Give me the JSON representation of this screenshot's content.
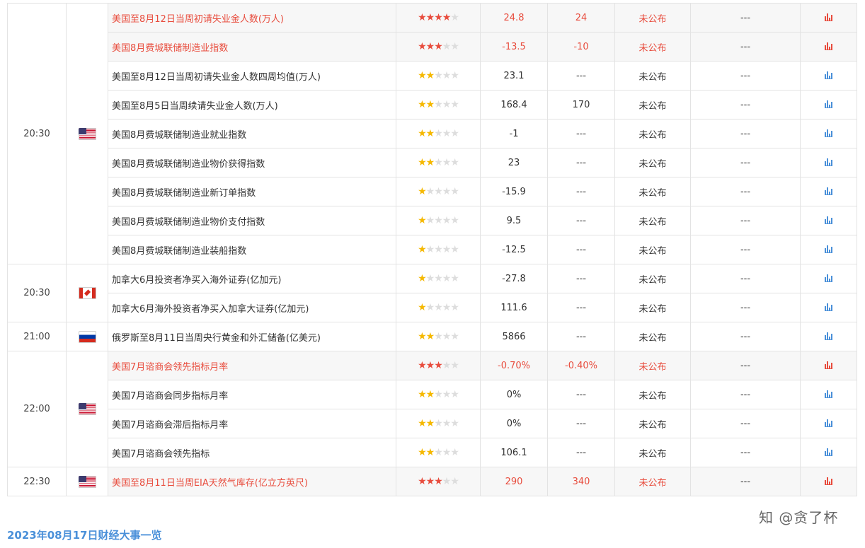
{
  "colors": {
    "accent_red": "#e84c3d",
    "star_yellow": "#f5b800",
    "link_blue": "#4a90d9"
  },
  "rows": [
    {
      "time": "",
      "flag": "",
      "event": "美国至8月12日当周初请失业金人数(万人)",
      "stars": 4,
      "previous": "24.8",
      "forecast": "24",
      "actual": "未公布",
      "impact": "---",
      "important": true
    },
    {
      "time": "",
      "flag": "",
      "event": "美国8月费城联储制造业指数",
      "stars": 3,
      "previous": "-13.5",
      "forecast": "-10",
      "actual": "未公布",
      "impact": "---",
      "important": true
    },
    {
      "time": "20:30",
      "flag": "us",
      "event": "美国至8月12日当周初请失业金人数四周均值(万人)",
      "stars": 2,
      "previous": "23.1",
      "forecast": "---",
      "actual": "未公布",
      "impact": "---",
      "important": false
    },
    {
      "time": "",
      "flag": "",
      "event": "美国至8月5日当周续请失业金人数(万人)",
      "stars": 2,
      "previous": "168.4",
      "forecast": "170",
      "actual": "未公布",
      "impact": "---",
      "important": false
    },
    {
      "time": "",
      "flag": "",
      "event": "美国8月费城联储制造业就业指数",
      "stars": 2,
      "previous": "-1",
      "forecast": "---",
      "actual": "未公布",
      "impact": "---",
      "important": false
    },
    {
      "time": "",
      "flag": "",
      "event": "美国8月费城联储制造业物价获得指数",
      "stars": 2,
      "previous": "23",
      "forecast": "---",
      "actual": "未公布",
      "impact": "---",
      "important": false
    },
    {
      "time": "",
      "flag": "",
      "event": "美国8月费城联储制造业新订单指数",
      "stars": 1,
      "previous": "-15.9",
      "forecast": "---",
      "actual": "未公布",
      "impact": "---",
      "important": false
    },
    {
      "time": "",
      "flag": "",
      "event": "美国8月费城联储制造业物价支付指数",
      "stars": 1,
      "previous": "9.5",
      "forecast": "---",
      "actual": "未公布",
      "impact": "---",
      "important": false
    },
    {
      "time": "",
      "flag": "",
      "event": "美国8月费城联储制造业装船指数",
      "stars": 1,
      "previous": "-12.5",
      "forecast": "---",
      "actual": "未公布",
      "impact": "---",
      "important": false
    },
    {
      "time": "20:30",
      "flag": "ca",
      "event": "加拿大6月投资者净买入海外证券(亿加元)",
      "stars": 1,
      "previous": "-27.8",
      "forecast": "---",
      "actual": "未公布",
      "impact": "---",
      "important": false
    },
    {
      "time": "",
      "flag": "",
      "event": "加拿大6月海外投资者净买入加拿大证券(亿加元)",
      "stars": 1,
      "previous": "111.6",
      "forecast": "---",
      "actual": "未公布",
      "impact": "---",
      "important": false
    },
    {
      "time": "21:00",
      "flag": "ru",
      "event": "俄罗斯至8月11日当周央行黄金和外汇储备(亿美元)",
      "stars": 2,
      "previous": "5866",
      "forecast": "---",
      "actual": "未公布",
      "impact": "---",
      "important": false
    },
    {
      "time": "",
      "flag": "",
      "event": "美国7月谘商会领先指标月率",
      "stars": 3,
      "previous": "-0.70%",
      "forecast": "-0.40%",
      "actual": "未公布",
      "impact": "---",
      "important": true
    },
    {
      "time": "22:00",
      "flag": "us",
      "event": "美国7月谘商会同步指标月率",
      "stars": 2,
      "previous": "0%",
      "forecast": "---",
      "actual": "未公布",
      "impact": "---",
      "important": false
    },
    {
      "time": "",
      "flag": "",
      "event": "美国7月谘商会滞后指标月率",
      "stars": 2,
      "previous": "0%",
      "forecast": "---",
      "actual": "未公布",
      "impact": "---",
      "important": false
    },
    {
      "time": "",
      "flag": "",
      "event": "美国7月谘商会领先指标",
      "stars": 2,
      "previous": "106.1",
      "forecast": "---",
      "actual": "未公布",
      "impact": "---",
      "important": false
    },
    {
      "time": "22:30",
      "flag": "us",
      "event": "美国至8月11日当周EIA天然气库存(亿立方英尺)",
      "stars": 3,
      "previous": "290",
      "forecast": "340",
      "actual": "未公布",
      "impact": "---",
      "important": true
    }
  ],
  "groups": [
    {
      "time": "20:30",
      "flag": "us",
      "start": 0,
      "span": 9
    },
    {
      "time": "20:30",
      "flag": "ca",
      "start": 9,
      "span": 2
    },
    {
      "time": "21:00",
      "flag": "ru",
      "start": 11,
      "span": 1
    },
    {
      "time": "22:00",
      "flag": "us",
      "start": 12,
      "span": 4
    },
    {
      "time": "22:30",
      "flag": "us",
      "start": 16,
      "span": 1
    }
  ],
  "footer": {
    "title": "2023年08月17日财经大事一览"
  },
  "watermark": {
    "text": "知 @贪了杯"
  }
}
